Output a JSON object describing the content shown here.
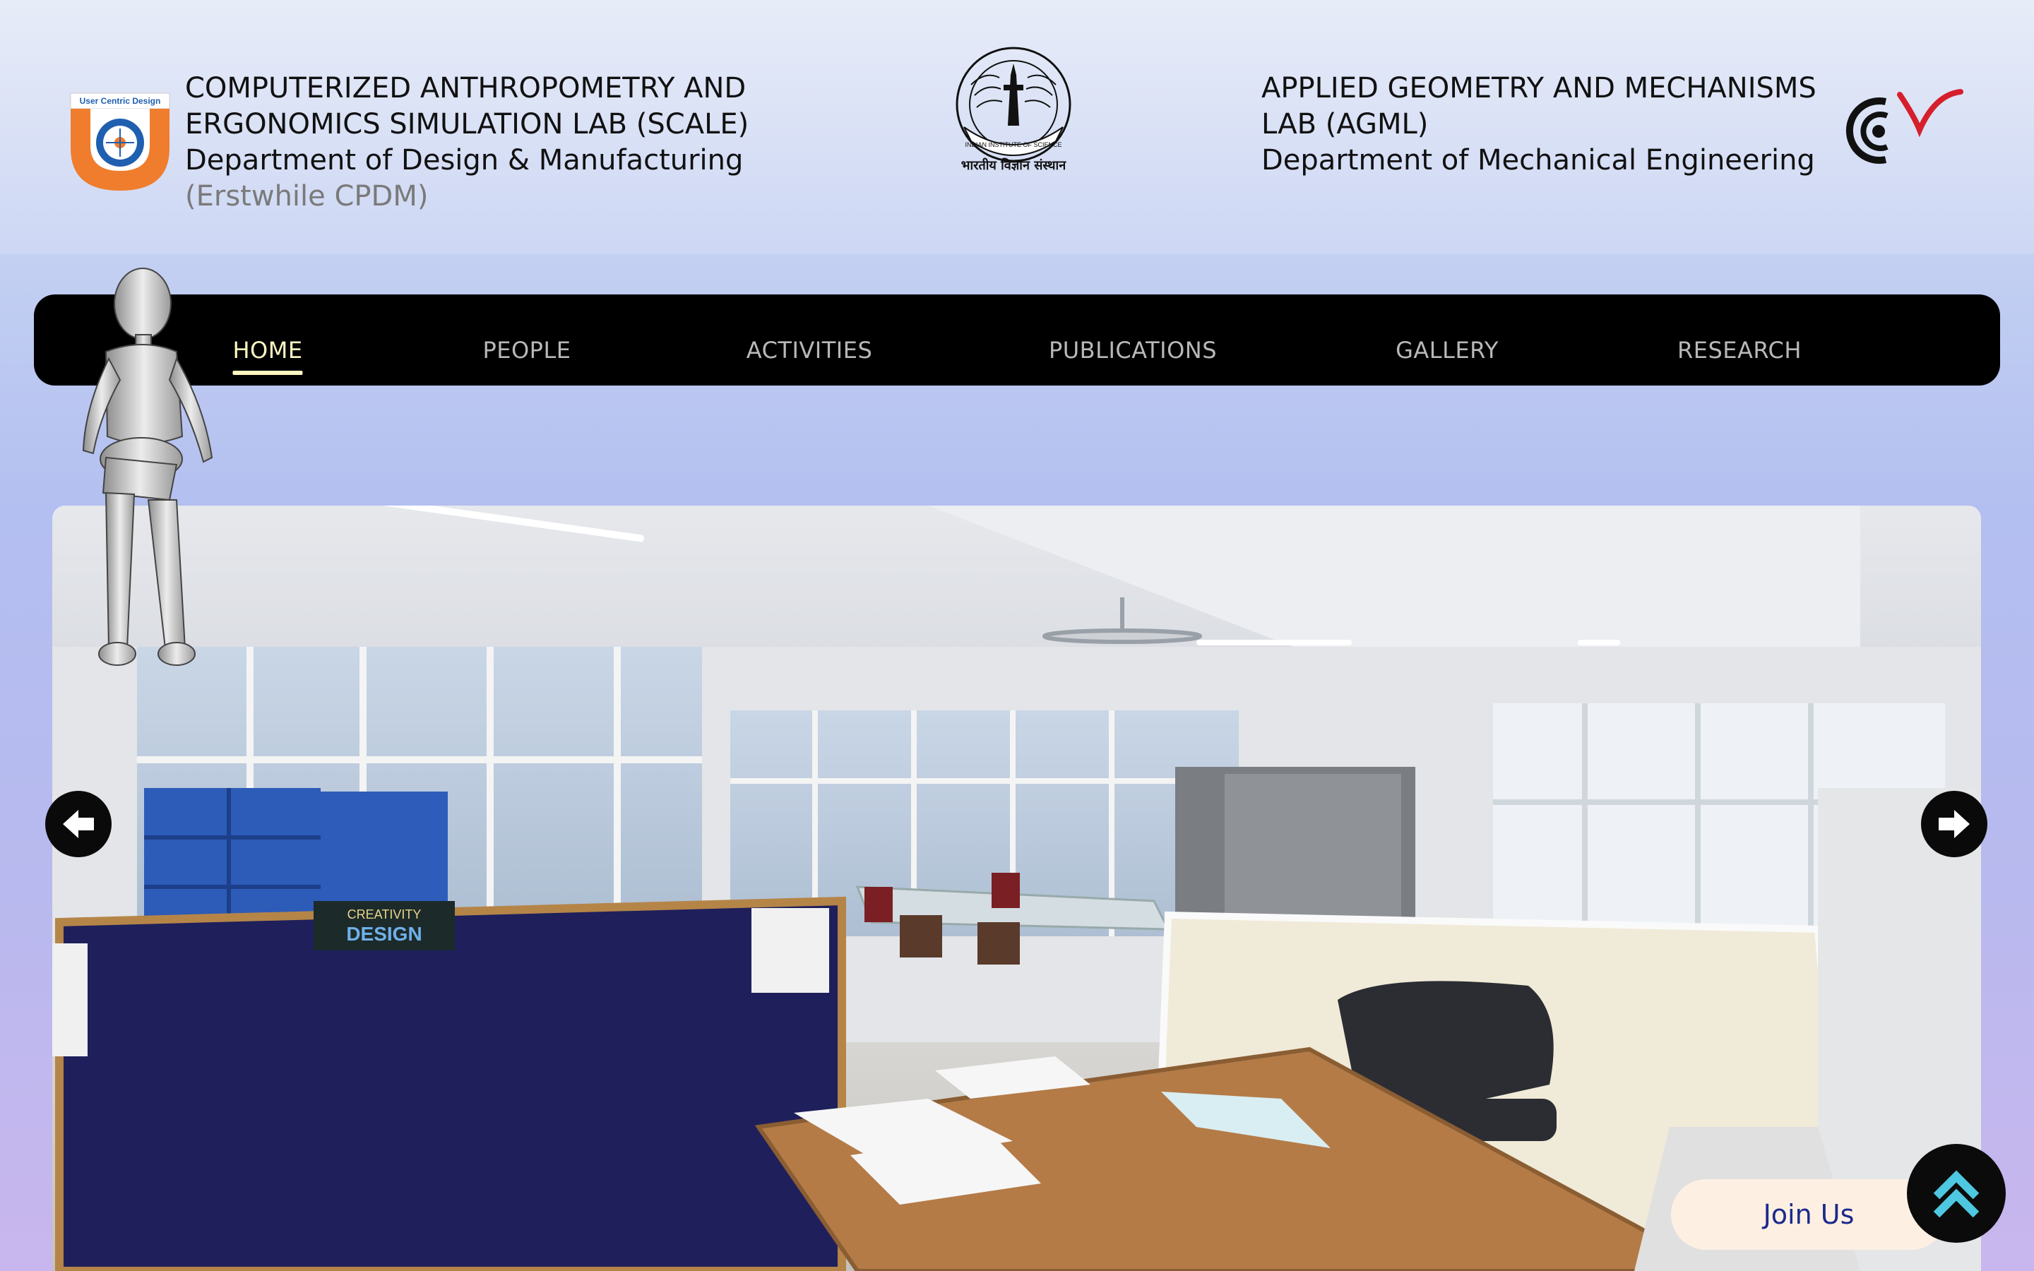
{
  "header": {
    "left_lab": {
      "line1": "COMPUTERIZED ANTHROPOMETRY AND",
      "line2": "ERGONOMICS SIMULATION LAB (SCALE)",
      "line3": "Department of Design & Manufacturing",
      "line4": "(Erstwhile CPDM)",
      "logo_text": "User Centric Design"
    },
    "center_logo": {
      "ring_text": "INDIAN INSTITUTE OF SCIENCE",
      "hindi_text": "भारतीय विज्ञान संस्थान"
    },
    "right_lab": {
      "line1": "APPLIED GEOMETRY AND MECHANISMS",
      "line2": "LAB (AGML)",
      "line3": "Department of Mechanical Engineering"
    }
  },
  "nav": {
    "items": [
      {
        "label": "HOME",
        "active": true
      },
      {
        "label": "PEOPLE"
      },
      {
        "label": "ACTIVITIES"
      },
      {
        "label": "PUBLICATIONS"
      },
      {
        "label": "GALLERY"
      },
      {
        "label": "RESEARCH"
      }
    ]
  },
  "hero": {
    "poster_line1": "CREATIVITY",
    "poster_line2": "DESIGN",
    "prev_icon": "arrow-left-icon",
    "next_icon": "arrow-right-icon"
  },
  "actions": {
    "join_label": "Join Us",
    "scroll_top_icon": "double-chevron-up-icon"
  },
  "colors": {
    "nav_bg": "#000000",
    "nav_active": "#fff7c2",
    "nav_inactive": "#b8b8b8",
    "join_text": "#1b2a8c",
    "join_bg": "#fdf0e3",
    "scroll_arrow": "#4ec8e0",
    "logo_orange": "#ef7d2d",
    "logo_blue": "#1f5fb0",
    "agml_red": "#d61f2c"
  }
}
